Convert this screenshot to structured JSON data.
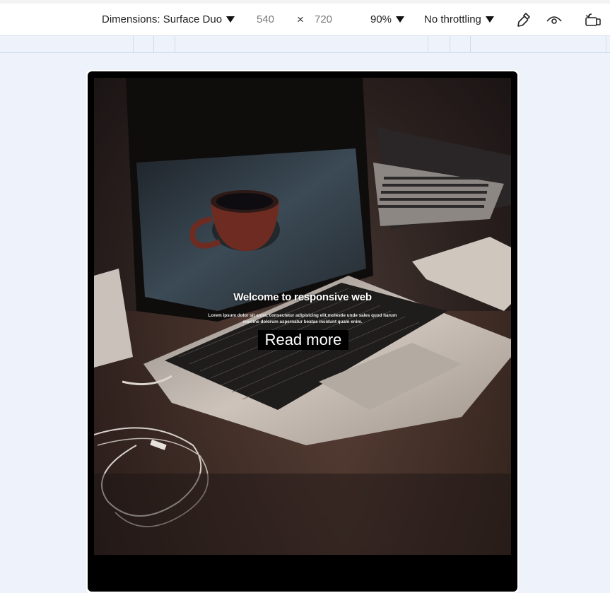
{
  "toolbar": {
    "dimensions_label": "Dimensions: Surface Duo",
    "width_value": "540",
    "times_glyph": "×",
    "height_value": "720",
    "zoom_value": "90%",
    "throttling_label": "No throttling",
    "icons": [
      "eyedropper-icon",
      "eye-icon",
      "rotate-device-icon"
    ]
  },
  "hero": {
    "title": "Welcome to responsive web",
    "body": "Lorem ipsum dolor sit amet, consectetur adipisicing elit.molestie unde sales quod harum maxime dolorum aspernatur beatae incidunt quam enim.",
    "button_label": "Read more"
  },
  "colors": {
    "toolbar_bg": "#ffffff",
    "page_bg": "#eef3fb",
    "device_frame": "#000000"
  }
}
